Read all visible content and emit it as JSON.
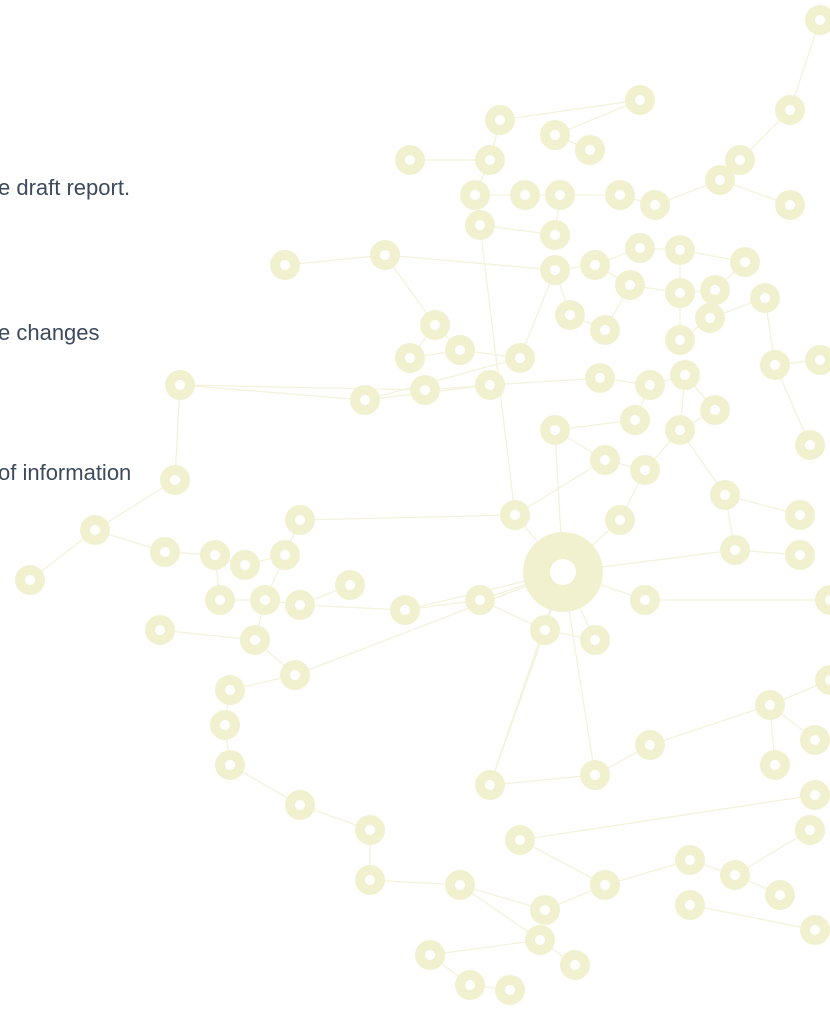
{
  "text_lines": [
    "e draft report.",
    "e changes",
    "of information"
  ],
  "decoration": {
    "name": "network-graph-illustration",
    "node_fill": "#f1f1d0",
    "node_hole": "#ffffff",
    "edge_color": "#f3f3dc",
    "text_color": "#3d4a5c"
  }
}
